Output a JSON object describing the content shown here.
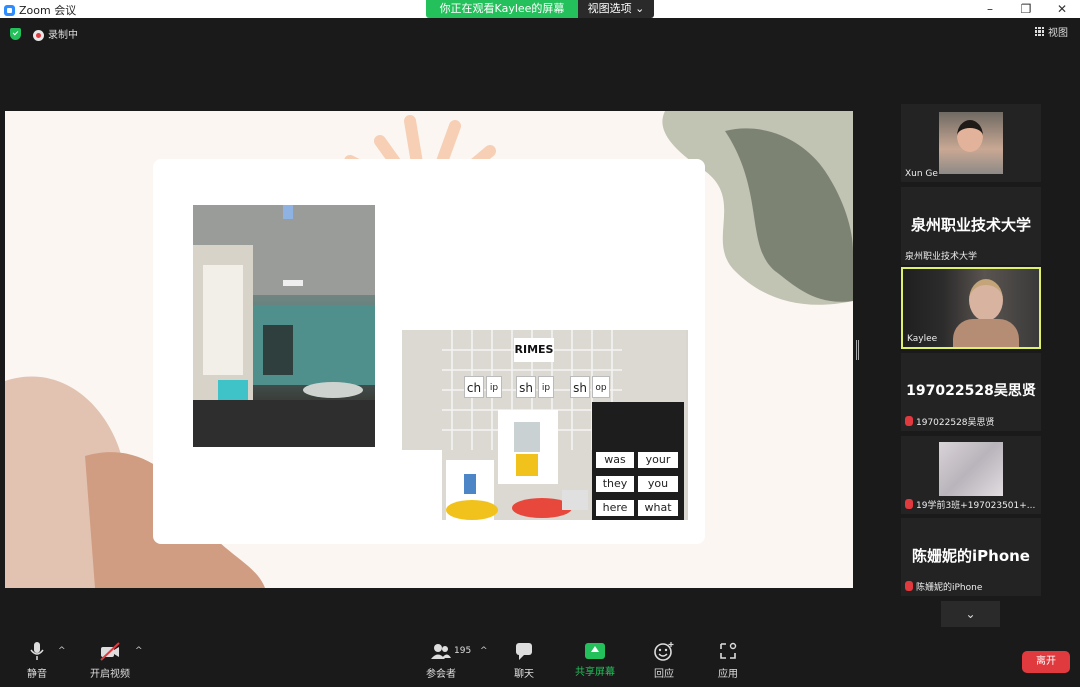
{
  "window": {
    "title": "Zoom 会议",
    "minimize": "–",
    "maximize": "❐",
    "close": "✕"
  },
  "share_banner": {
    "text": "你正在观看Kaylee的屏幕",
    "view_options": "视图选项 ⌄"
  },
  "status": {
    "recording": "录制中"
  },
  "view_button": {
    "label": "视图"
  },
  "slide": {
    "rimes_label": "RIMES",
    "rime_cards": [
      "ch",
      "ip",
      "sh",
      "ip",
      "sh",
      "op"
    ],
    "sight_words": [
      "was",
      "your",
      "they",
      "you",
      "here",
      "what"
    ]
  },
  "participants": [
    {
      "name": "Xun Ge",
      "big": ""
    },
    {
      "name": "泉州职业技术大学",
      "big": "泉州职业技术大学"
    },
    {
      "name": "Kaylee",
      "big": ""
    },
    {
      "name": "197022528吴思贤",
      "big": "197022528吴思贤"
    },
    {
      "name": "19学前3班+197023501+...",
      "big": ""
    },
    {
      "name": "陈姗妮的iPhone",
      "big": "陈姗妮的iPhone"
    }
  ],
  "more_participants": "⌄",
  "toolbar": {
    "mute": "静音",
    "video": "开启视频",
    "participants": "参会者",
    "participant_count": "195",
    "chat": "聊天",
    "share": "共享屏幕",
    "reactions": "回应",
    "apps": "应用",
    "leave": "离开",
    "caret": "^"
  },
  "colors": {
    "accent_green": "#23c05b",
    "leave_red": "#e0393e",
    "active_speaker": "#dff06b"
  }
}
